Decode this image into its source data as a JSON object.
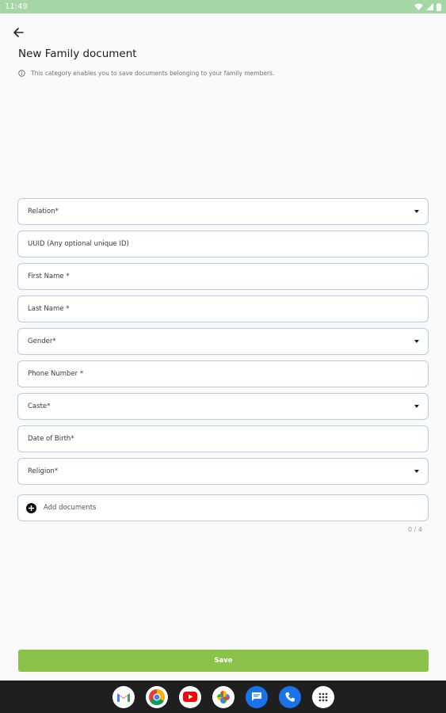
{
  "status_bar": {
    "time": "11:49"
  },
  "page": {
    "title": "New Family document",
    "info_text": "This category enables you to save documents belonging to your family members."
  },
  "form": {
    "fields": [
      {
        "label": "Relation*",
        "type": "dropdown"
      },
      {
        "label": "UUID (Any optional unique ID)",
        "type": "text"
      },
      {
        "label": "First Name *",
        "type": "text"
      },
      {
        "label": "Last Name *",
        "type": "text"
      },
      {
        "label": "Gender*",
        "type": "dropdown"
      },
      {
        "label": "Phone Number *",
        "type": "text"
      },
      {
        "label": "Caste*",
        "type": "dropdown"
      },
      {
        "label": "Date of Birth*",
        "type": "text"
      },
      {
        "label": "Religion*",
        "type": "dropdown"
      }
    ],
    "add_documents_label": "Add documents",
    "documents_counter": "0 / 4",
    "save_label": "Save"
  },
  "colors": {
    "status_bar": "#a5d6a7",
    "field_border": "#b3cde6",
    "save_button": "#8bc34a",
    "nav_bar": "#1f1f1f"
  },
  "nav_apps": [
    "gmail-icon",
    "chrome-icon",
    "youtube-icon",
    "photos-icon",
    "messages-icon",
    "phone-icon",
    "app-drawer-icon"
  ]
}
